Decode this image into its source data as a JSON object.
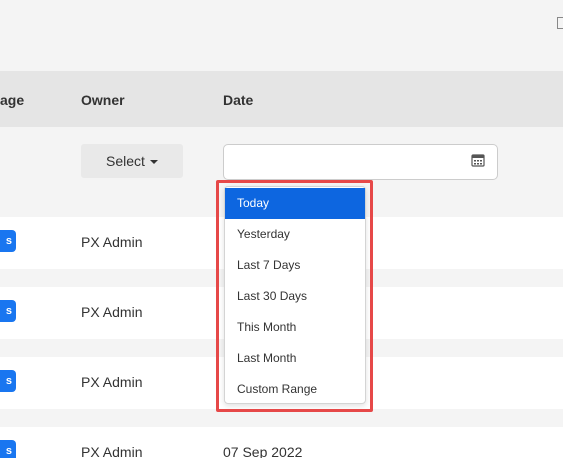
{
  "header": {
    "col_stage_fragment": "age",
    "col_owner": "Owner",
    "col_date": "Date"
  },
  "filters": {
    "owner_select_label": "Select",
    "date_input_value": ""
  },
  "date_range_menu": {
    "options": [
      "Today",
      "Yesterday",
      "Last 7 Days",
      "Last 30 Days",
      "This Month",
      "Last Month",
      "Custom Range"
    ],
    "active_option": "Today"
  },
  "rows": [
    {
      "badge": "s",
      "owner": "PX Admin",
      "date": ""
    },
    {
      "badge": "s",
      "owner": "PX Admin",
      "date": ""
    },
    {
      "badge": "s",
      "owner": "PX Admin",
      "date": ""
    },
    {
      "badge": "s",
      "owner": "PX Admin",
      "date": "07 Sep 2022"
    }
  ],
  "colors": {
    "accent": "#0d66e0",
    "badge": "#1976f0",
    "highlight": "#e64848"
  },
  "icons": {
    "date_input": "calendar-icon",
    "dropdown_caret": "caret-down-icon"
  }
}
